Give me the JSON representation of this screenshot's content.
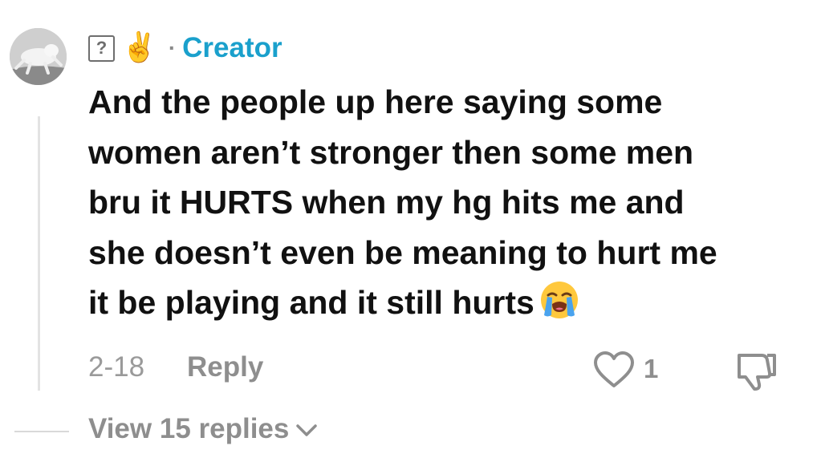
{
  "comment": {
    "author_badge": "Creator",
    "separator": "·",
    "unknown_glyph": "?",
    "peace_emoji": "✌️",
    "text": "And the people up here saying some\nwomen aren’t stronger then some men\nbru it HURTS when my hg hits me and\nshe doesn’t even be meaning to hurt me\nit be playing and it still hurts",
    "trailing_emoji": "loudly-crying-face-icon",
    "date": "2-18",
    "reply_label": "Reply",
    "like_count": "1",
    "view_replies_label": "View 15 replies"
  },
  "colors": {
    "creator_accent": "#1aa0cc",
    "text_primary": "#111111",
    "text_muted": "#8e8e8e"
  }
}
